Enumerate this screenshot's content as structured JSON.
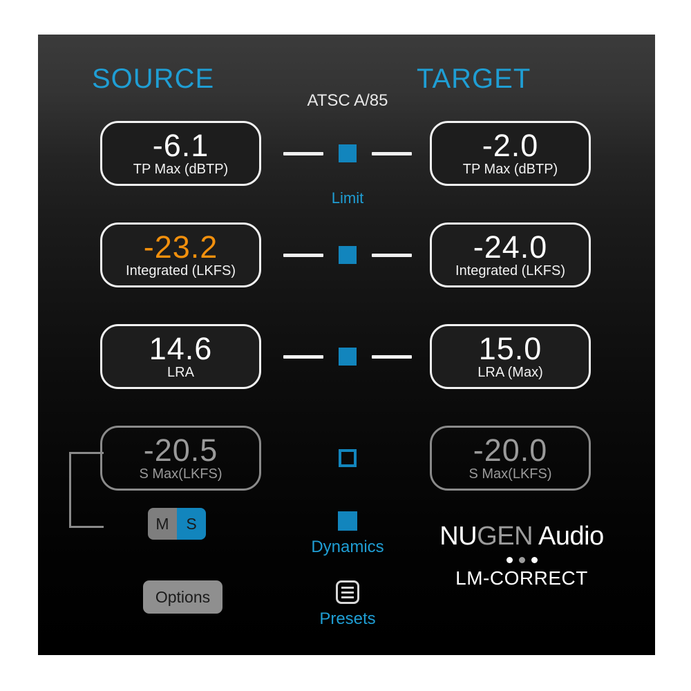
{
  "plugin": {
    "brand_prefix": "NU",
    "brand_mid": "GEN",
    "brand_suffix": " Audio",
    "product": "LM-CORRECT"
  },
  "headings": {
    "source": "SOURCE",
    "target": "TARGET",
    "standard": "ATSC A/85"
  },
  "rows": [
    {
      "id": "tp-max",
      "source_value": "-6.1",
      "source_label": "TP Max (dBTP)",
      "target_value": "-2.0",
      "target_label": "TP Max (dBTP)",
      "link_caption": "Limit",
      "link_checked": true,
      "dashes": true,
      "dimmed": false,
      "source_warn": false
    },
    {
      "id": "integrated",
      "source_value": "-23.2",
      "source_label": "Integrated (LKFS)",
      "target_value": "-24.0",
      "target_label": "Integrated (LKFS)",
      "link_caption": "",
      "link_checked": true,
      "dashes": true,
      "dimmed": false,
      "source_warn": true
    },
    {
      "id": "lra",
      "source_value": "14.6",
      "source_label": "LRA",
      "target_value": "15.0",
      "target_label": "LRA (Max)",
      "link_caption": "",
      "link_checked": true,
      "dashes": true,
      "dimmed": false,
      "source_warn": false
    },
    {
      "id": "s-max",
      "source_value": "-20.5",
      "source_label": "S Max(LKFS)",
      "target_value": "-20.0",
      "target_label": "S Max(LKFS)",
      "link_caption": "",
      "link_checked": false,
      "dashes": false,
      "dimmed": true,
      "source_warn": false
    }
  ],
  "ms_toggle": {
    "m_label": "M",
    "s_label": "S",
    "selected": "S"
  },
  "options": {
    "label": "Options"
  },
  "dynamics": {
    "label": "Dynamics",
    "checked": true
  },
  "presets": {
    "label": "Presets",
    "icon": "list-icon"
  },
  "colors": {
    "accent_blue": "#1f9ed4",
    "control_blue": "#1285bd",
    "warn_orange": "#f2900d",
    "text_white": "#f2f2f2",
    "dim_grey": "#9a9a9a",
    "button_grey": "#8f8f8f"
  }
}
